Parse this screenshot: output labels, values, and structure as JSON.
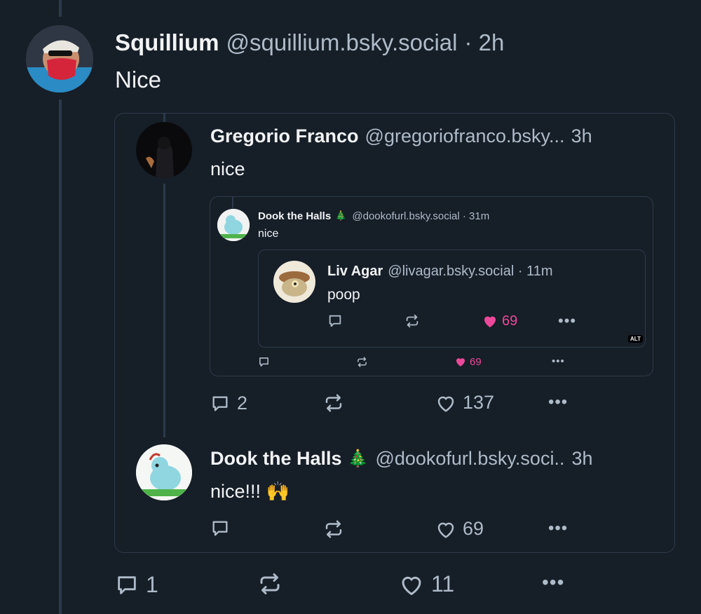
{
  "main_post": {
    "author": "Squillium",
    "handle": "@squillium.bsky.social",
    "time": "· 2h",
    "text": "Nice",
    "actions": {
      "replies": "1",
      "likes": "11"
    }
  },
  "quote_post": {
    "author": "Gregorio Franco",
    "handle": "@gregoriofranco.bsky...",
    "time": "3h",
    "text": "nice",
    "actions": {
      "replies": "2",
      "likes": "137"
    }
  },
  "screenshot_post": {
    "author": "Dook the Halls",
    "handle": "@dookofurl.bsky.social · 31m",
    "text": "nice",
    "actions": {
      "likes": "69"
    }
  },
  "screenshot_inner_post": {
    "author": "Liv Agar",
    "handle": "@livagar.bsky.social · 11m",
    "text": "poop",
    "actions": {
      "likes": "69"
    },
    "alt_badge": "ALT"
  },
  "reply_post": {
    "author": "Dook the Halls",
    "emoji": "🎄",
    "handle": "@dookofurl.bsky.soci..",
    "time": "3h",
    "text": "nice!!! 🙌",
    "actions": {
      "likes": "69"
    }
  },
  "colors": {
    "background": "#161e27",
    "border": "#2e3c4d",
    "thread_line": "#2c3a4b",
    "text_primary": "#f1f3f5",
    "text_secondary": "#aebbc9",
    "like_pink": "#ec4899"
  },
  "icons": [
    "reply-icon",
    "repost-icon",
    "like-icon",
    "more-icon",
    "tree-icon"
  ]
}
